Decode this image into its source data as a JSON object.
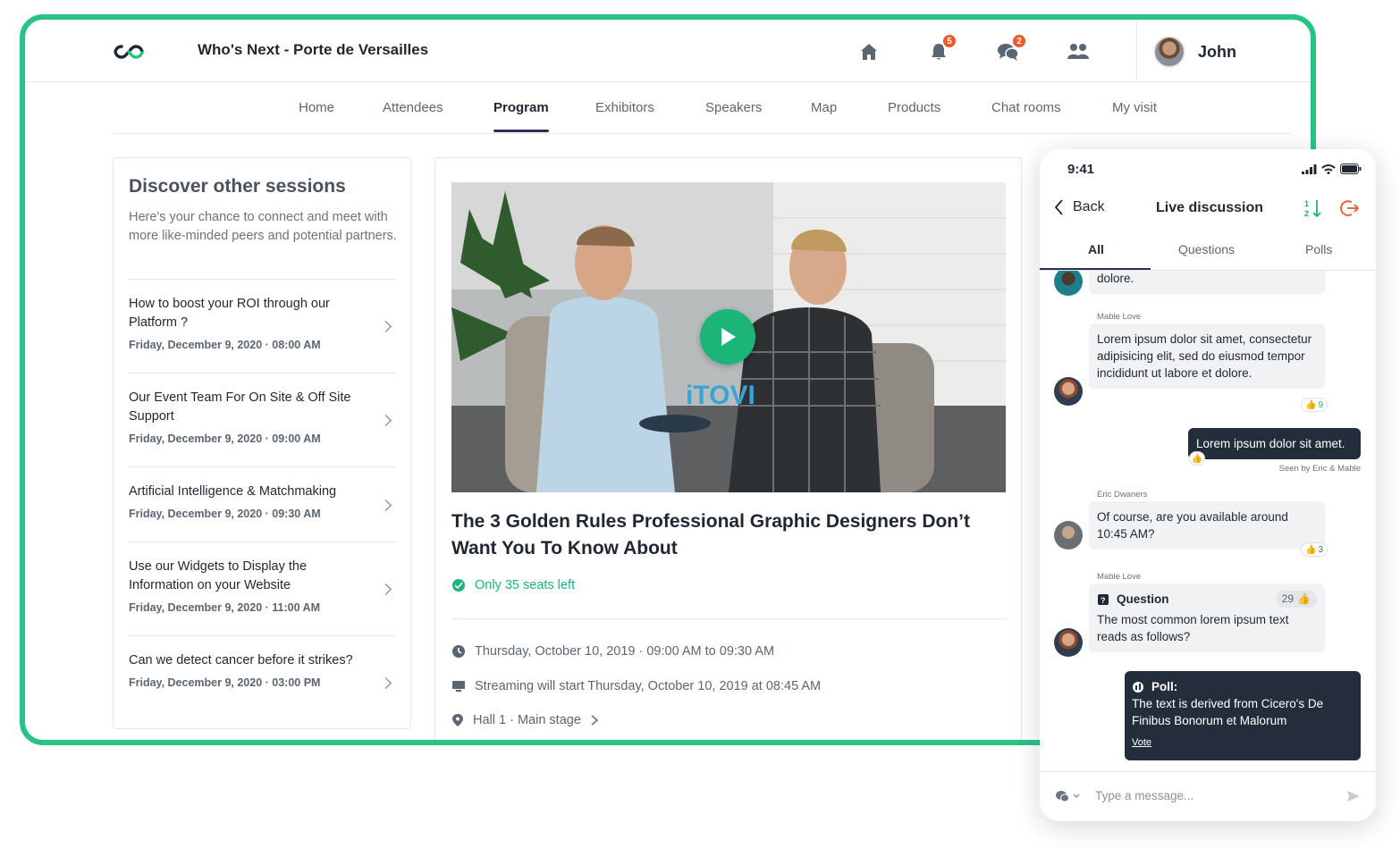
{
  "header": {
    "event_title": "Who's Next - Porte de Versailles",
    "notification_count": "5",
    "messages_count": "2",
    "user_name": "John"
  },
  "nav": {
    "items": [
      "Home",
      "Attendees",
      "Program",
      "Exhibitors",
      "Speakers",
      "Map",
      "Products",
      "Chat rooms",
      "My visit"
    ],
    "active": "Program"
  },
  "sessions_panel": {
    "title": "Discover other sessions",
    "intro": "Here's your chance to connect and meet with more like-minded peers and potential partners.",
    "sessions": [
      {
        "title": "How to boost your ROI through our Platform ?",
        "date": "Friday, December 9, 2020 · 08:00 AM"
      },
      {
        "title": "Our Event Team For On Site & Off Site Support",
        "date": "Friday, December 9, 2020 · 09:00 AM"
      },
      {
        "title": "Artificial Intelligence & Matchmaking",
        "date": "Friday, December 9, 2020 · 09:30 AM"
      },
      {
        "title": "Use our Widgets to Display the Information on your Website",
        "date": "Friday, December 9, 2020 · 11:00 AM"
      },
      {
        "title": "Can we detect cancer before it strikes?",
        "date": "Friday, December 9, 2020 · 03:00 PM"
      }
    ]
  },
  "session_detail": {
    "video_watermark": "iTOVI",
    "title": "The 3 Golden Rules Professional Graphic Designers Don’t Want You To Know About",
    "seats": "Only 35 seats left",
    "datetime": "Thursday, October 10, 2019 · 09:00 AM to 09:30 AM",
    "streaming": "Streaming will start Thursday, October 10, 2019 at 08:45 AM",
    "location": "Hall 1 · Main stage"
  },
  "phone": {
    "time": "9:41",
    "back_label": "Back",
    "title": "Live discussion",
    "sort_label": "1 2",
    "tabs": [
      "All",
      "Questions",
      "Polls"
    ],
    "messages": {
      "first_tail": "dolore.",
      "m1_sender": "Mable Love",
      "m1_text": "Lorem ipsum dolor sit amet, consectetur adipisicing elit, sed do eiusmod tempor incididunt ut labore et dolore.",
      "m1_likes": "9",
      "m2_text": "Lorem ipsum dolor sit amet.",
      "m2_seen": "Seen by Eric & Mable",
      "m3_sender": "Eric Dwaners",
      "m3_text": "Of course, are you available around 10:45 AM?",
      "m3_likes": "3",
      "m4_sender": "Mable Love",
      "m4_label": "Question",
      "m4_votes": "29",
      "m4_text": "The most common lorem ipsum text reads as follows?",
      "poll_label": "Poll:",
      "poll_text": "The text is derived from Cicero's De Finibus Bonorum et Malorum",
      "poll_vote": "Vote"
    },
    "input_placeholder": "Type a message..."
  },
  "colors": {
    "accent": "#26c485",
    "badge": "#f2572b",
    "dark": "#242d3c",
    "leave": "#f2572b"
  }
}
